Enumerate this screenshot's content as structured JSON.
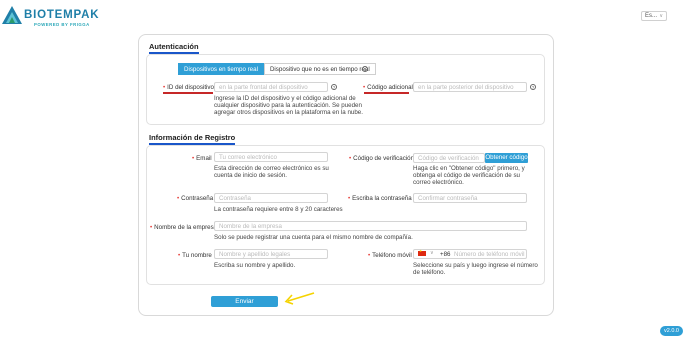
{
  "header": {
    "logo_text": "BIOTEMPAK",
    "logo_tagline": "POWERED BY FRIGGA",
    "language": "Es..."
  },
  "auth": {
    "title": "Autenticación",
    "tabs": [
      {
        "label": "Dispositivos en tiempo real",
        "active": true
      },
      {
        "label": "Dispositivo que no es en tiempo real",
        "active": false
      }
    ],
    "device_id_label": "ID del dispositivo",
    "device_id_placeholder": "en la parte frontal del dispositivo",
    "extra_code_label": "Código adicional",
    "extra_code_placeholder": "en la parte posterior del dispositivo",
    "device_hint": "Ingrese la ID del dispositivo y el código adicional de cualquier dispositivo para la autenticación. Se pueden agregar otros dispositivos en la plataforma en la nube."
  },
  "registration": {
    "title": "Información de Registro",
    "email_label": "Email",
    "email_placeholder": "Tu correo electrónico",
    "email_hint": "Esta dirección de correo electrónico es su cuenta de inicio de sesión.",
    "verify_label": "Código de verificación",
    "verify_placeholder": "Código de verificación",
    "verify_button": "Obtener código",
    "verify_hint": "Haga clic en \"Obtener código\" primero, y obtenga el código de verificación de su correo electrónico.",
    "password_label": "Contraseña",
    "password_placeholder": "Contraseña",
    "password_hint": "La contraseña requiere entre 8 y 20 caracteres",
    "confirm_label": "Escriba la contraseña otr",
    "confirm_placeholder": "Confirmar contraseña",
    "company_label": "Nombre de la empresa",
    "company_placeholder": "Nombre de la empresa",
    "company_hint": "Solo se puede registrar una cuenta para el mismo nombre de compañía.",
    "name_label": "Tu nombre",
    "name_placeholder": "Nombre y apellido legales",
    "name_hint": "Escriba su nombre y apellido.",
    "phone_label": "Teléfono móvil",
    "phone_code": "+86",
    "phone_placeholder": "Número de teléfono móvil",
    "phone_hint": "Seleccione su país y luego ingrese el número de teléfono."
  },
  "submit_label": "Enviar",
  "version": "v2.0.0",
  "colors": {
    "accent": "#2f9fd6",
    "title_underline": "#1a56c9",
    "required": "#e53935"
  }
}
